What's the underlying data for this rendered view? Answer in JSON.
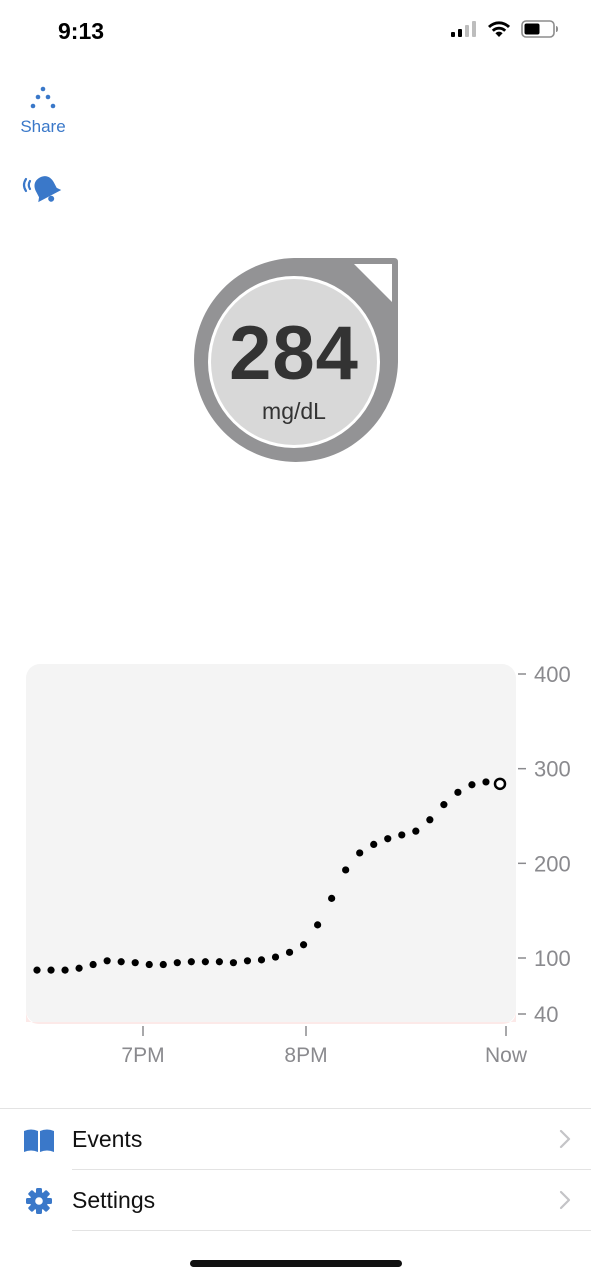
{
  "status_bar": {
    "time": "9:13",
    "signal_icon": "cellular-signal-icon",
    "wifi_icon": "wifi-icon",
    "battery_icon": "battery-icon"
  },
  "toolbar": {
    "share_label": "Share",
    "share_icon": "share-dots-icon",
    "alert_icon": "alert-bell-icon"
  },
  "glucose": {
    "value": "284",
    "unit": "mg/dL",
    "badge_color": "#939395",
    "trend_arrow": "none"
  },
  "chart_data": {
    "type": "scatter",
    "x_labels": [
      "7PM",
      "8PM",
      "Now"
    ],
    "y_ticks": [
      40,
      100,
      200,
      300,
      400
    ],
    "ylim": [
      40,
      400
    ],
    "low_band": [
      40,
      70
    ],
    "high_band_color": "#f4f4f4",
    "low_band_color": "#fce9e8",
    "series": [
      {
        "values": [
          87,
          87,
          87,
          89,
          93,
          97,
          96,
          95,
          93,
          93,
          95,
          96,
          96,
          96,
          95,
          97,
          98,
          101,
          106,
          114,
          135,
          163,
          193,
          211,
          220,
          226,
          230,
          234,
          246,
          262,
          275,
          283,
          286,
          284
        ]
      }
    ],
    "current_point_hollow": true,
    "grid": false
  },
  "menu": {
    "items": [
      {
        "label": "Events",
        "icon": "book-icon"
      },
      {
        "label": "Settings",
        "icon": "gear-icon"
      }
    ]
  },
  "colors": {
    "accent": "#3a78c9",
    "badge_gray": "#939395",
    "badge_inner": "#d8d8d8",
    "text_dark": "#333333",
    "axis_text": "#8a8a8e"
  }
}
